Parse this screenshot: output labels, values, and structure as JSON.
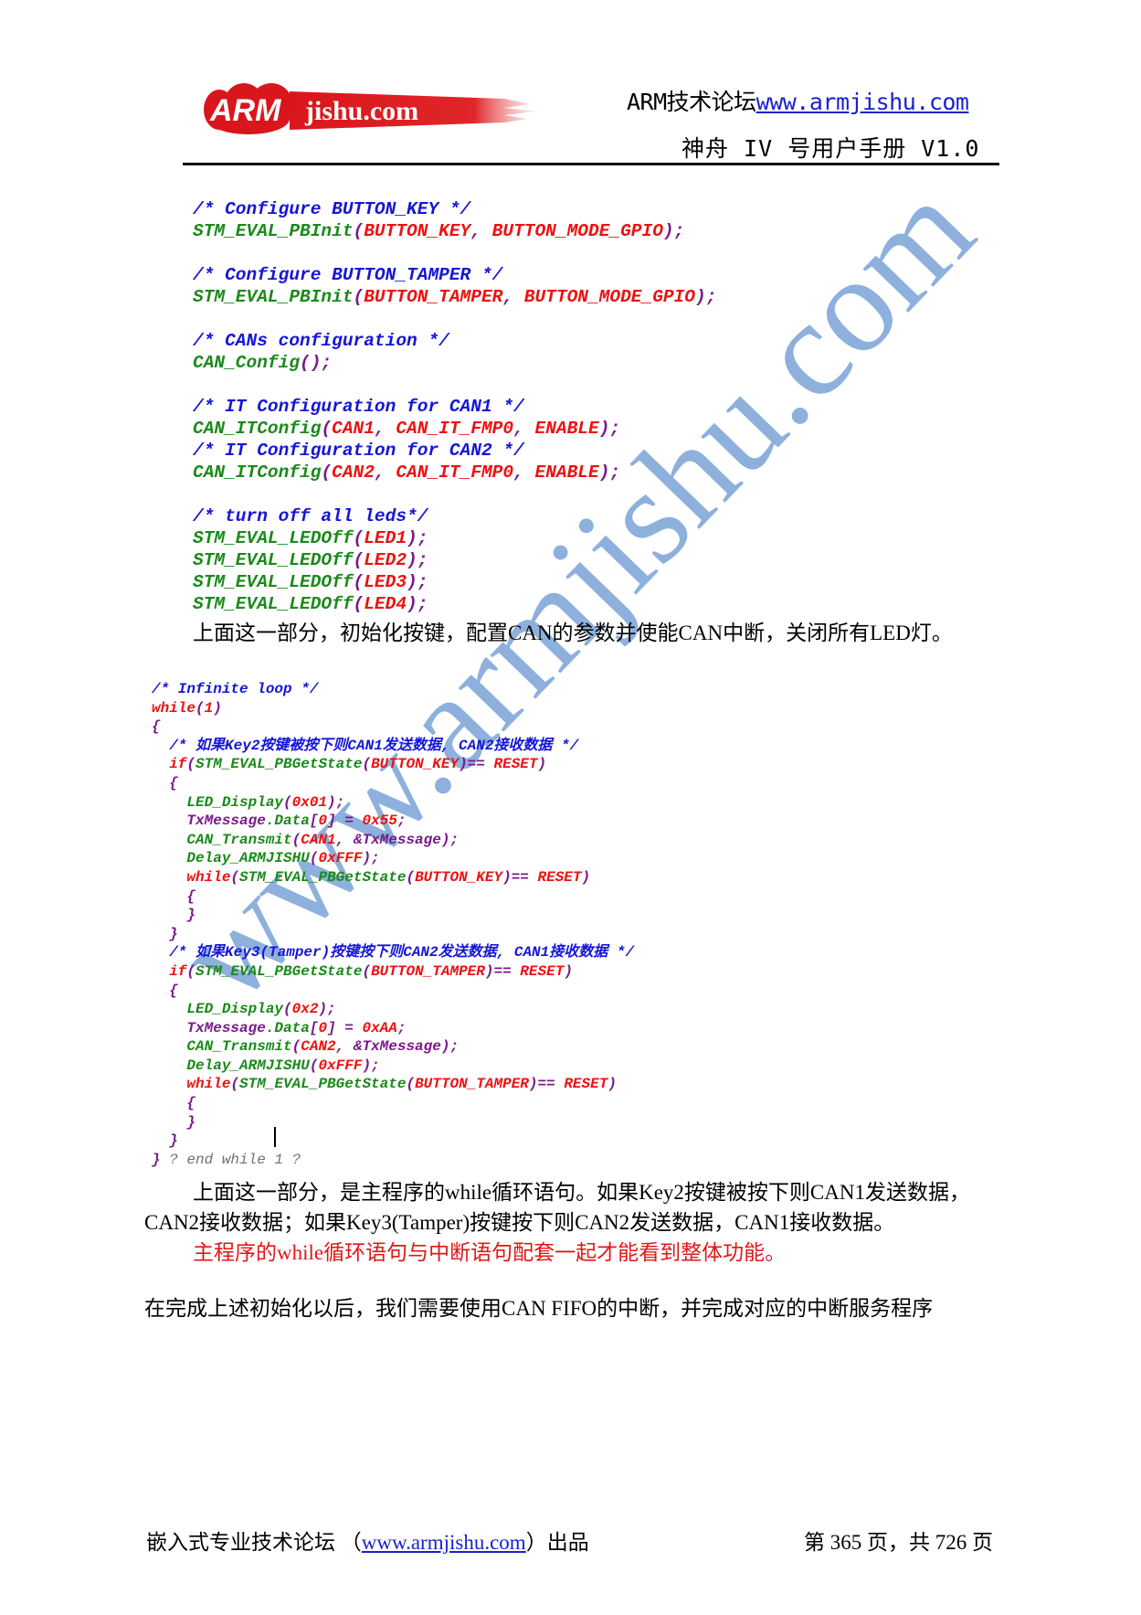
{
  "header": {
    "logo": {
      "mark": "ARM",
      "text": "jishu.com",
      "color": "#d9161c"
    },
    "forum_label": "ARM技术论坛",
    "forum_url": "www.armjishu.com",
    "manual_title": "神舟 IV 号用户手册  V1.0"
  },
  "code_block_1": [
    {
      "tokens": [
        {
          "t": "/* Configure BUTTON_KEY */",
          "c": "cm"
        }
      ]
    },
    {
      "tokens": [
        {
          "t": "STM_EVAL_PBInit",
          "c": "fn"
        },
        {
          "t": "(",
          "c": "pu"
        },
        {
          "t": "BUTTON_KEY",
          "c": "ar"
        },
        {
          "t": ", ",
          "c": "pu"
        },
        {
          "t": "BUTTON_MODE_GPIO",
          "c": "ar"
        },
        {
          "t": ");",
          "c": "pu"
        }
      ]
    },
    {
      "tokens": []
    },
    {
      "tokens": [
        {
          "t": "/* Configure BUTTON_TAMPER */",
          "c": "cm"
        }
      ]
    },
    {
      "tokens": [
        {
          "t": "STM_EVAL_PBInit",
          "c": "fn"
        },
        {
          "t": "(",
          "c": "pu"
        },
        {
          "t": "BUTTON_TAMPER",
          "c": "ar"
        },
        {
          "t": ", ",
          "c": "pu"
        },
        {
          "t": "BUTTON_MODE_GPIO",
          "c": "ar"
        },
        {
          "t": ");",
          "c": "pu"
        }
      ]
    },
    {
      "tokens": []
    },
    {
      "tokens": [
        {
          "t": "/* CANs configuration */",
          "c": "cm"
        }
      ]
    },
    {
      "tokens": [
        {
          "t": "CAN_Config",
          "c": "fn"
        },
        {
          "t": "();",
          "c": "pu"
        }
      ]
    },
    {
      "tokens": []
    },
    {
      "tokens": [
        {
          "t": "/* IT Configuration for CAN1 */",
          "c": "cm"
        }
      ]
    },
    {
      "tokens": [
        {
          "t": "CAN_ITConfig",
          "c": "fn"
        },
        {
          "t": "(",
          "c": "pu"
        },
        {
          "t": "CAN1",
          "c": "ar"
        },
        {
          "t": ", ",
          "c": "pu"
        },
        {
          "t": "CAN_IT_FMP0",
          "c": "ar"
        },
        {
          "t": ", ",
          "c": "pu"
        },
        {
          "t": "ENABLE",
          "c": "ar"
        },
        {
          "t": ");",
          "c": "pu"
        }
      ]
    },
    {
      "tokens": [
        {
          "t": "/* IT Configuration for CAN2 */",
          "c": "cm"
        }
      ]
    },
    {
      "tokens": [
        {
          "t": "CAN_ITConfig",
          "c": "fn"
        },
        {
          "t": "(",
          "c": "pu"
        },
        {
          "t": "CAN2",
          "c": "ar"
        },
        {
          "t": ", ",
          "c": "pu"
        },
        {
          "t": "CAN_IT_FMP0",
          "c": "ar"
        },
        {
          "t": ", ",
          "c": "pu"
        },
        {
          "t": "ENABLE",
          "c": "ar"
        },
        {
          "t": ");",
          "c": "pu"
        }
      ]
    },
    {
      "tokens": []
    },
    {
      "tokens": [
        {
          "t": "/* turn off all leds*/",
          "c": "cm"
        }
      ]
    },
    {
      "tokens": [
        {
          "t": "STM_EVAL_LEDOff",
          "c": "fn"
        },
        {
          "t": "(",
          "c": "pu"
        },
        {
          "t": "LED1",
          "c": "ar"
        },
        {
          "t": ");",
          "c": "pu"
        }
      ]
    },
    {
      "tokens": [
        {
          "t": "STM_EVAL_LEDOff",
          "c": "fn"
        },
        {
          "t": "(",
          "c": "pu"
        },
        {
          "t": "LED2",
          "c": "ar"
        },
        {
          "t": ");",
          "c": "pu"
        }
      ]
    },
    {
      "tokens": [
        {
          "t": "STM_EVAL_LEDOff",
          "c": "fn"
        },
        {
          "t": "(",
          "c": "pu"
        },
        {
          "t": "LED3",
          "c": "ar"
        },
        {
          "t": ");",
          "c": "pu"
        }
      ]
    },
    {
      "tokens": [
        {
          "t": "STM_EVAL_LEDOff",
          "c": "fn"
        },
        {
          "t": "(",
          "c": "pu"
        },
        {
          "t": "LED4",
          "c": "ar"
        },
        {
          "t": ");",
          "c": "pu"
        }
      ]
    }
  ],
  "paragraph_1": "上面这一部分，初始化按键，配置CAN的参数并使能CAN中断，关闭所有LED灯。",
  "code_block_2": [
    {
      "tokens": [
        {
          "t": "/* Infinite loop */",
          "c": "cm"
        }
      ]
    },
    {
      "tokens": [
        {
          "t": "while",
          "c": "ar"
        },
        {
          "t": "(",
          "c": "pu"
        },
        {
          "t": "1",
          "c": "ar"
        },
        {
          "t": ")",
          "c": "pu"
        }
      ]
    },
    {
      "tokens": [
        {
          "t": "{",
          "c": "pu"
        }
      ]
    },
    {
      "tokens": [
        {
          "t": "  /* 如果Key2按键被按下则CAN1发送数据, CAN2接收数据 */",
          "c": "cm"
        }
      ]
    },
    {
      "tokens": [
        {
          "t": "  if",
          "c": "ar"
        },
        {
          "t": "(",
          "c": "pu"
        },
        {
          "t": "STM_EVAL_PBGetState",
          "c": "fn"
        },
        {
          "t": "(",
          "c": "pu"
        },
        {
          "t": "BUTTON_KEY",
          "c": "ar"
        },
        {
          "t": ")== ",
          "c": "pu"
        },
        {
          "t": "RESET",
          "c": "ar"
        },
        {
          "t": ")",
          "c": "pu"
        }
      ]
    },
    {
      "tokens": [
        {
          "t": "  {",
          "c": "pu"
        }
      ]
    },
    {
      "tokens": [
        {
          "t": "    LED_Display",
          "c": "fn"
        },
        {
          "t": "(",
          "c": "pu"
        },
        {
          "t": "0x01",
          "c": "ar"
        },
        {
          "t": ");",
          "c": "pu"
        }
      ]
    },
    {
      "tokens": [
        {
          "t": "    TxMessage",
          "c": "pu"
        },
        {
          "t": ".Data",
          "c": "fn"
        },
        {
          "t": "[",
          "c": "pu"
        },
        {
          "t": "0",
          "c": "ar"
        },
        {
          "t": "] = ",
          "c": "pu"
        },
        {
          "t": "0x55",
          "c": "ar"
        },
        {
          "t": ";",
          "c": "pu"
        }
      ]
    },
    {
      "tokens": [
        {
          "t": "    CAN_Transmit",
          "c": "fn"
        },
        {
          "t": "(",
          "c": "pu"
        },
        {
          "t": "CAN1",
          "c": "ar"
        },
        {
          "t": ", &TxMessage);",
          "c": "pu"
        }
      ]
    },
    {
      "tokens": [
        {
          "t": "    Delay_ARMJISHU",
          "c": "fn"
        },
        {
          "t": "(",
          "c": "pu"
        },
        {
          "t": "0xFFF",
          "c": "ar"
        },
        {
          "t": ");",
          "c": "pu"
        }
      ]
    },
    {
      "tokens": [
        {
          "t": "    while",
          "c": "ar"
        },
        {
          "t": "(",
          "c": "pu"
        },
        {
          "t": "STM_EVAL_PBGetState",
          "c": "fn"
        },
        {
          "t": "(",
          "c": "pu"
        },
        {
          "t": "BUTTON_KEY",
          "c": "ar"
        },
        {
          "t": ")== ",
          "c": "pu"
        },
        {
          "t": "RESET",
          "c": "ar"
        },
        {
          "t": ")",
          "c": "pu"
        }
      ]
    },
    {
      "tokens": [
        {
          "t": "    {",
          "c": "pu"
        }
      ]
    },
    {
      "tokens": [
        {
          "t": "    }",
          "c": "pu"
        }
      ]
    },
    {
      "tokens": [
        {
          "t": "  }",
          "c": "pu"
        }
      ]
    },
    {
      "tokens": [
        {
          "t": "  /* 如果Key3(Tamper)按键按下则CAN2发送数据, CAN1接收数据 */",
          "c": "cm"
        }
      ]
    },
    {
      "tokens": [
        {
          "t": "  if",
          "c": "ar"
        },
        {
          "t": "(",
          "c": "pu"
        },
        {
          "t": "STM_EVAL_PBGetState",
          "c": "fn"
        },
        {
          "t": "(",
          "c": "pu"
        },
        {
          "t": "BUTTON_TAMPER",
          "c": "ar"
        },
        {
          "t": ")== ",
          "c": "pu"
        },
        {
          "t": "RESET",
          "c": "ar"
        },
        {
          "t": ")",
          "c": "pu"
        }
      ]
    },
    {
      "tokens": [
        {
          "t": "  {",
          "c": "pu"
        }
      ]
    },
    {
      "tokens": [
        {
          "t": "    LED_Display",
          "c": "fn"
        },
        {
          "t": "(",
          "c": "pu"
        },
        {
          "t": "0x2",
          "c": "ar"
        },
        {
          "t": ");",
          "c": "pu"
        }
      ]
    },
    {
      "tokens": [
        {
          "t": "    TxMessage",
          "c": "pu"
        },
        {
          "t": ".Data",
          "c": "fn"
        },
        {
          "t": "[",
          "c": "pu"
        },
        {
          "t": "0",
          "c": "ar"
        },
        {
          "t": "] = ",
          "c": "pu"
        },
        {
          "t": "0xAA",
          "c": "ar"
        },
        {
          "t": ";",
          "c": "pu"
        }
      ]
    },
    {
      "tokens": [
        {
          "t": "    CAN_Transmit",
          "c": "fn"
        },
        {
          "t": "(",
          "c": "pu"
        },
        {
          "t": "CAN2",
          "c": "ar"
        },
        {
          "t": ", &TxMessage);",
          "c": "pu"
        }
      ]
    },
    {
      "tokens": [
        {
          "t": "    Delay_ARMJISHU",
          "c": "fn"
        },
        {
          "t": "(",
          "c": "pu"
        },
        {
          "t": "0xFFF",
          "c": "ar"
        },
        {
          "t": ");",
          "c": "pu"
        }
      ]
    },
    {
      "tokens": [
        {
          "t": "    while",
          "c": "ar"
        },
        {
          "t": "(",
          "c": "pu"
        },
        {
          "t": "STM_EVAL_PBGetState",
          "c": "fn"
        },
        {
          "t": "(",
          "c": "pu"
        },
        {
          "t": "BUTTON_TAMPER",
          "c": "ar"
        },
        {
          "t": ")== ",
          "c": "pu"
        },
        {
          "t": "RESET",
          "c": "ar"
        },
        {
          "t": ")",
          "c": "pu"
        }
      ]
    },
    {
      "tokens": [
        {
          "t": "    {",
          "c": "pu"
        }
      ]
    },
    {
      "tokens": [
        {
          "t": "    }",
          "c": "pu"
        }
      ]
    },
    {
      "tokens": [
        {
          "t": "  }",
          "c": "pu"
        }
      ]
    },
    {
      "tokens": [
        {
          "t": "} ",
          "c": "pu"
        },
        {
          "t": "? end while 1 ?",
          "c": "gr"
        }
      ]
    }
  ],
  "paragraph_2_line1": "上面这一部分，是主程序的while循环语句。如果Key2按键被按下则CAN1发送数据，",
  "paragraph_2_line2": "CAN2接收数据；如果Key3(Tamper)按键按下则CAN2发送数据，CAN1接收数据。",
  "paragraph_3_red": "主程序的while循环语句与中断语句配套一起才能看到整体功能。",
  "paragraph_4": "在完成上述初始化以后，我们需要使用CAN FIFO的中断，并完成对应的中断服务程序",
  "watermark": "www.armjishu.com",
  "footer": {
    "left_prefix": "嵌入式专业技术论坛  （",
    "link": "www.armjishu.com",
    "left_suffix": "）出品",
    "page_info": "第 365 页，共 726 页"
  }
}
